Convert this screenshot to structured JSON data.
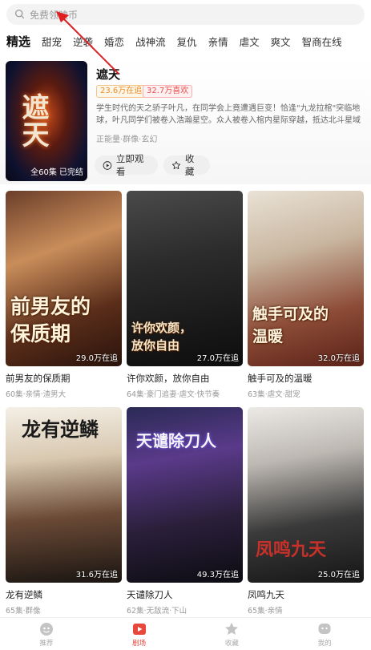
{
  "search": {
    "placeholder": "免费领映币"
  },
  "tabs": [
    "精选",
    "甜宠",
    "逆袭",
    "婚恋",
    "战神流",
    "复仇",
    "亲情",
    "虐文",
    "爽文",
    "智商在线"
  ],
  "featured": {
    "title": "遮天",
    "cover_title": "遮天",
    "cover_meta": "全60集  已完结",
    "badge_following": "23.6万在追",
    "badge_likes": "32.7万喜欢",
    "description": "学生时代的天之骄子叶凡，在同学会上竟遭遇巨变！恰逢\"九龙拉棺\"突临地球，叶凡同学们被卷入浩瀚星空。众人被卷入棺内星际穿越，抵达北斗星域荒古禁地…",
    "tags": "正能量·群像·玄幻",
    "play_label": "立即观看",
    "fav_label": "收藏"
  },
  "cards": [
    {
      "title": "前男友的保质期",
      "sub": "60集·亲情·渣男大",
      "count": "29.0万在追",
      "art": "前男友的\n保质期"
    },
    {
      "title": "许你欢颜，放你自由",
      "sub": "64集·豪门追妻·虐文·快节奏",
      "count": "27.0万在追",
      "art": "许你欢颜，\n放你自由"
    },
    {
      "title": "触手可及的温暖",
      "sub": "63集·虐文·甜宠",
      "count": "32.0万在追",
      "art": "触手可及的\n温暖"
    },
    {
      "title": "龙有逆鳞",
      "sub": "65集·群像",
      "count": "31.6万在追",
      "art": "龙有逆鳞"
    },
    {
      "title": "天谴除刀人",
      "sub": "62集·无敌流·下山",
      "count": "49.3万在追",
      "art": "天谴除刀人"
    },
    {
      "title": "凤鸣九天",
      "sub": "65集·亲情",
      "count": "25.0万在追",
      "art": "凤鸣九天"
    }
  ],
  "nav": [
    {
      "label": "推荐",
      "icon": "recommend-icon"
    },
    {
      "label": "剧场",
      "icon": "theater-icon"
    },
    {
      "label": "收藏",
      "icon": "star-icon"
    },
    {
      "label": "我的",
      "icon": "profile-icon"
    }
  ],
  "colors": {
    "accent": "#e8473c",
    "badge_orange": "#e8902a",
    "badge_red": "#e84c4c"
  }
}
